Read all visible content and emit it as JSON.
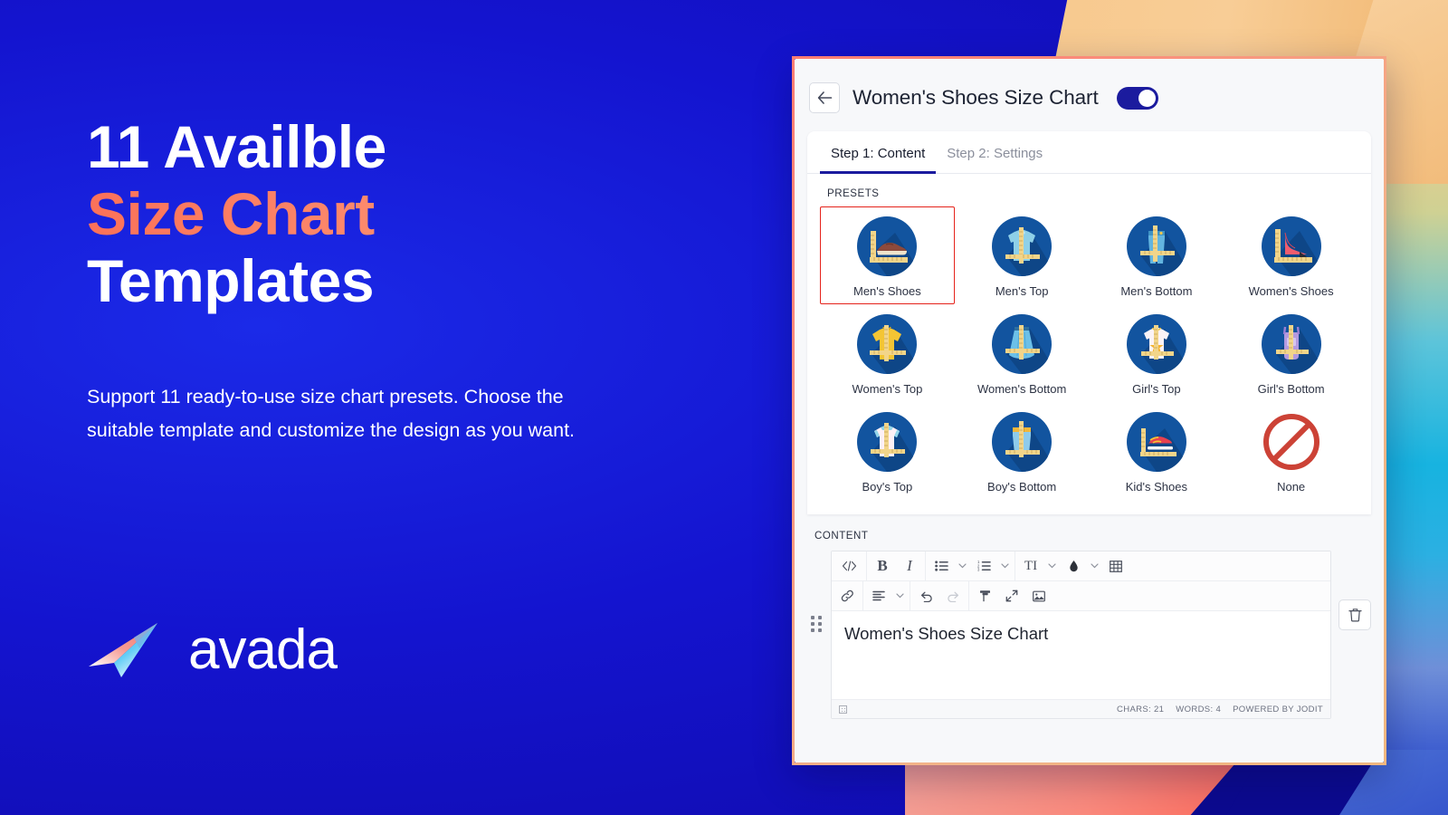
{
  "marketing": {
    "headline_line1": "11 Availble",
    "headline_line2": "Size Chart",
    "headline_line3": "Templates",
    "subcopy": "Support 11 ready-to-use size chart presets. Choose the suitable template and customize the design as you want.",
    "logo_word": "avada",
    "accent_color": "#fb7159",
    "accent_color_end": "#f9c18c",
    "background_color": "#1414cf"
  },
  "app": {
    "title": "Women's Shoes Size Chart",
    "back_icon": "arrow-left-icon",
    "toggle_on": true,
    "toggle_color": "#1b1b9e",
    "tabs": [
      {
        "label": "Step 1: Content",
        "active": true
      },
      {
        "label": "Step 2: Settings",
        "active": false
      }
    ],
    "presets_label": "PRESETS",
    "presets": [
      {
        "label": "Men's Shoes",
        "icon": "mens-shoe-icon",
        "selected": true
      },
      {
        "label": "Men's Top",
        "icon": "mens-shirt-icon",
        "selected": false
      },
      {
        "label": "Men's Bottom",
        "icon": "mens-jeans-icon",
        "selected": false
      },
      {
        "label": "Women's Shoes",
        "icon": "womens-heel-icon",
        "selected": false
      },
      {
        "label": "Women's Top",
        "icon": "womens-tshirt-icon",
        "selected": false
      },
      {
        "label": "Women's Bottom",
        "icon": "womens-skirt-icon",
        "selected": false
      },
      {
        "label": "Girl's Top",
        "icon": "girls-tshirt-icon",
        "selected": false
      },
      {
        "label": "Girl's Bottom",
        "icon": "girls-overall-icon",
        "selected": false
      },
      {
        "label": "Boy's Top",
        "icon": "boys-tshirt-icon",
        "selected": false
      },
      {
        "label": "Boy's Bottom",
        "icon": "boys-shorts-icon",
        "selected": false
      },
      {
        "label": "Kid's Shoes",
        "icon": "kids-sneaker-icon",
        "selected": false
      },
      {
        "label": "None",
        "icon": "no-entry-icon",
        "selected": false
      }
    ],
    "selection_border_color": "#e5231b",
    "content_label": "CONTENT",
    "editor": {
      "value": "Women's Shoes Size Chart",
      "toolbar_row1": [
        {
          "icon": "source-code-icon",
          "label": "</>"
        },
        {
          "icon": "bold-icon",
          "label": "B"
        },
        {
          "icon": "italic-icon",
          "label": "I"
        },
        {
          "icon": "bullet-list-icon",
          "caret": true
        },
        {
          "icon": "numbered-list-icon",
          "caret": true
        },
        {
          "icon": "font-size-icon",
          "label": "TI",
          "caret": true
        },
        {
          "icon": "text-color-icon",
          "caret": true
        },
        {
          "icon": "table-icon"
        }
      ],
      "toolbar_row2": [
        {
          "icon": "link-icon"
        },
        {
          "icon": "align-left-icon",
          "caret": true
        },
        {
          "icon": "undo-icon"
        },
        {
          "icon": "redo-icon",
          "disabled": true
        },
        {
          "icon": "format-brush-icon"
        },
        {
          "icon": "fullscreen-icon"
        },
        {
          "icon": "image-icon"
        }
      ],
      "status": {
        "chars": "CHARS: 21",
        "words": "WORDS: 4",
        "powered_by": "POWERED BY JODIT"
      },
      "drag_handle_icon": "drag-dots-icon",
      "delete_icon": "trash-icon"
    }
  }
}
